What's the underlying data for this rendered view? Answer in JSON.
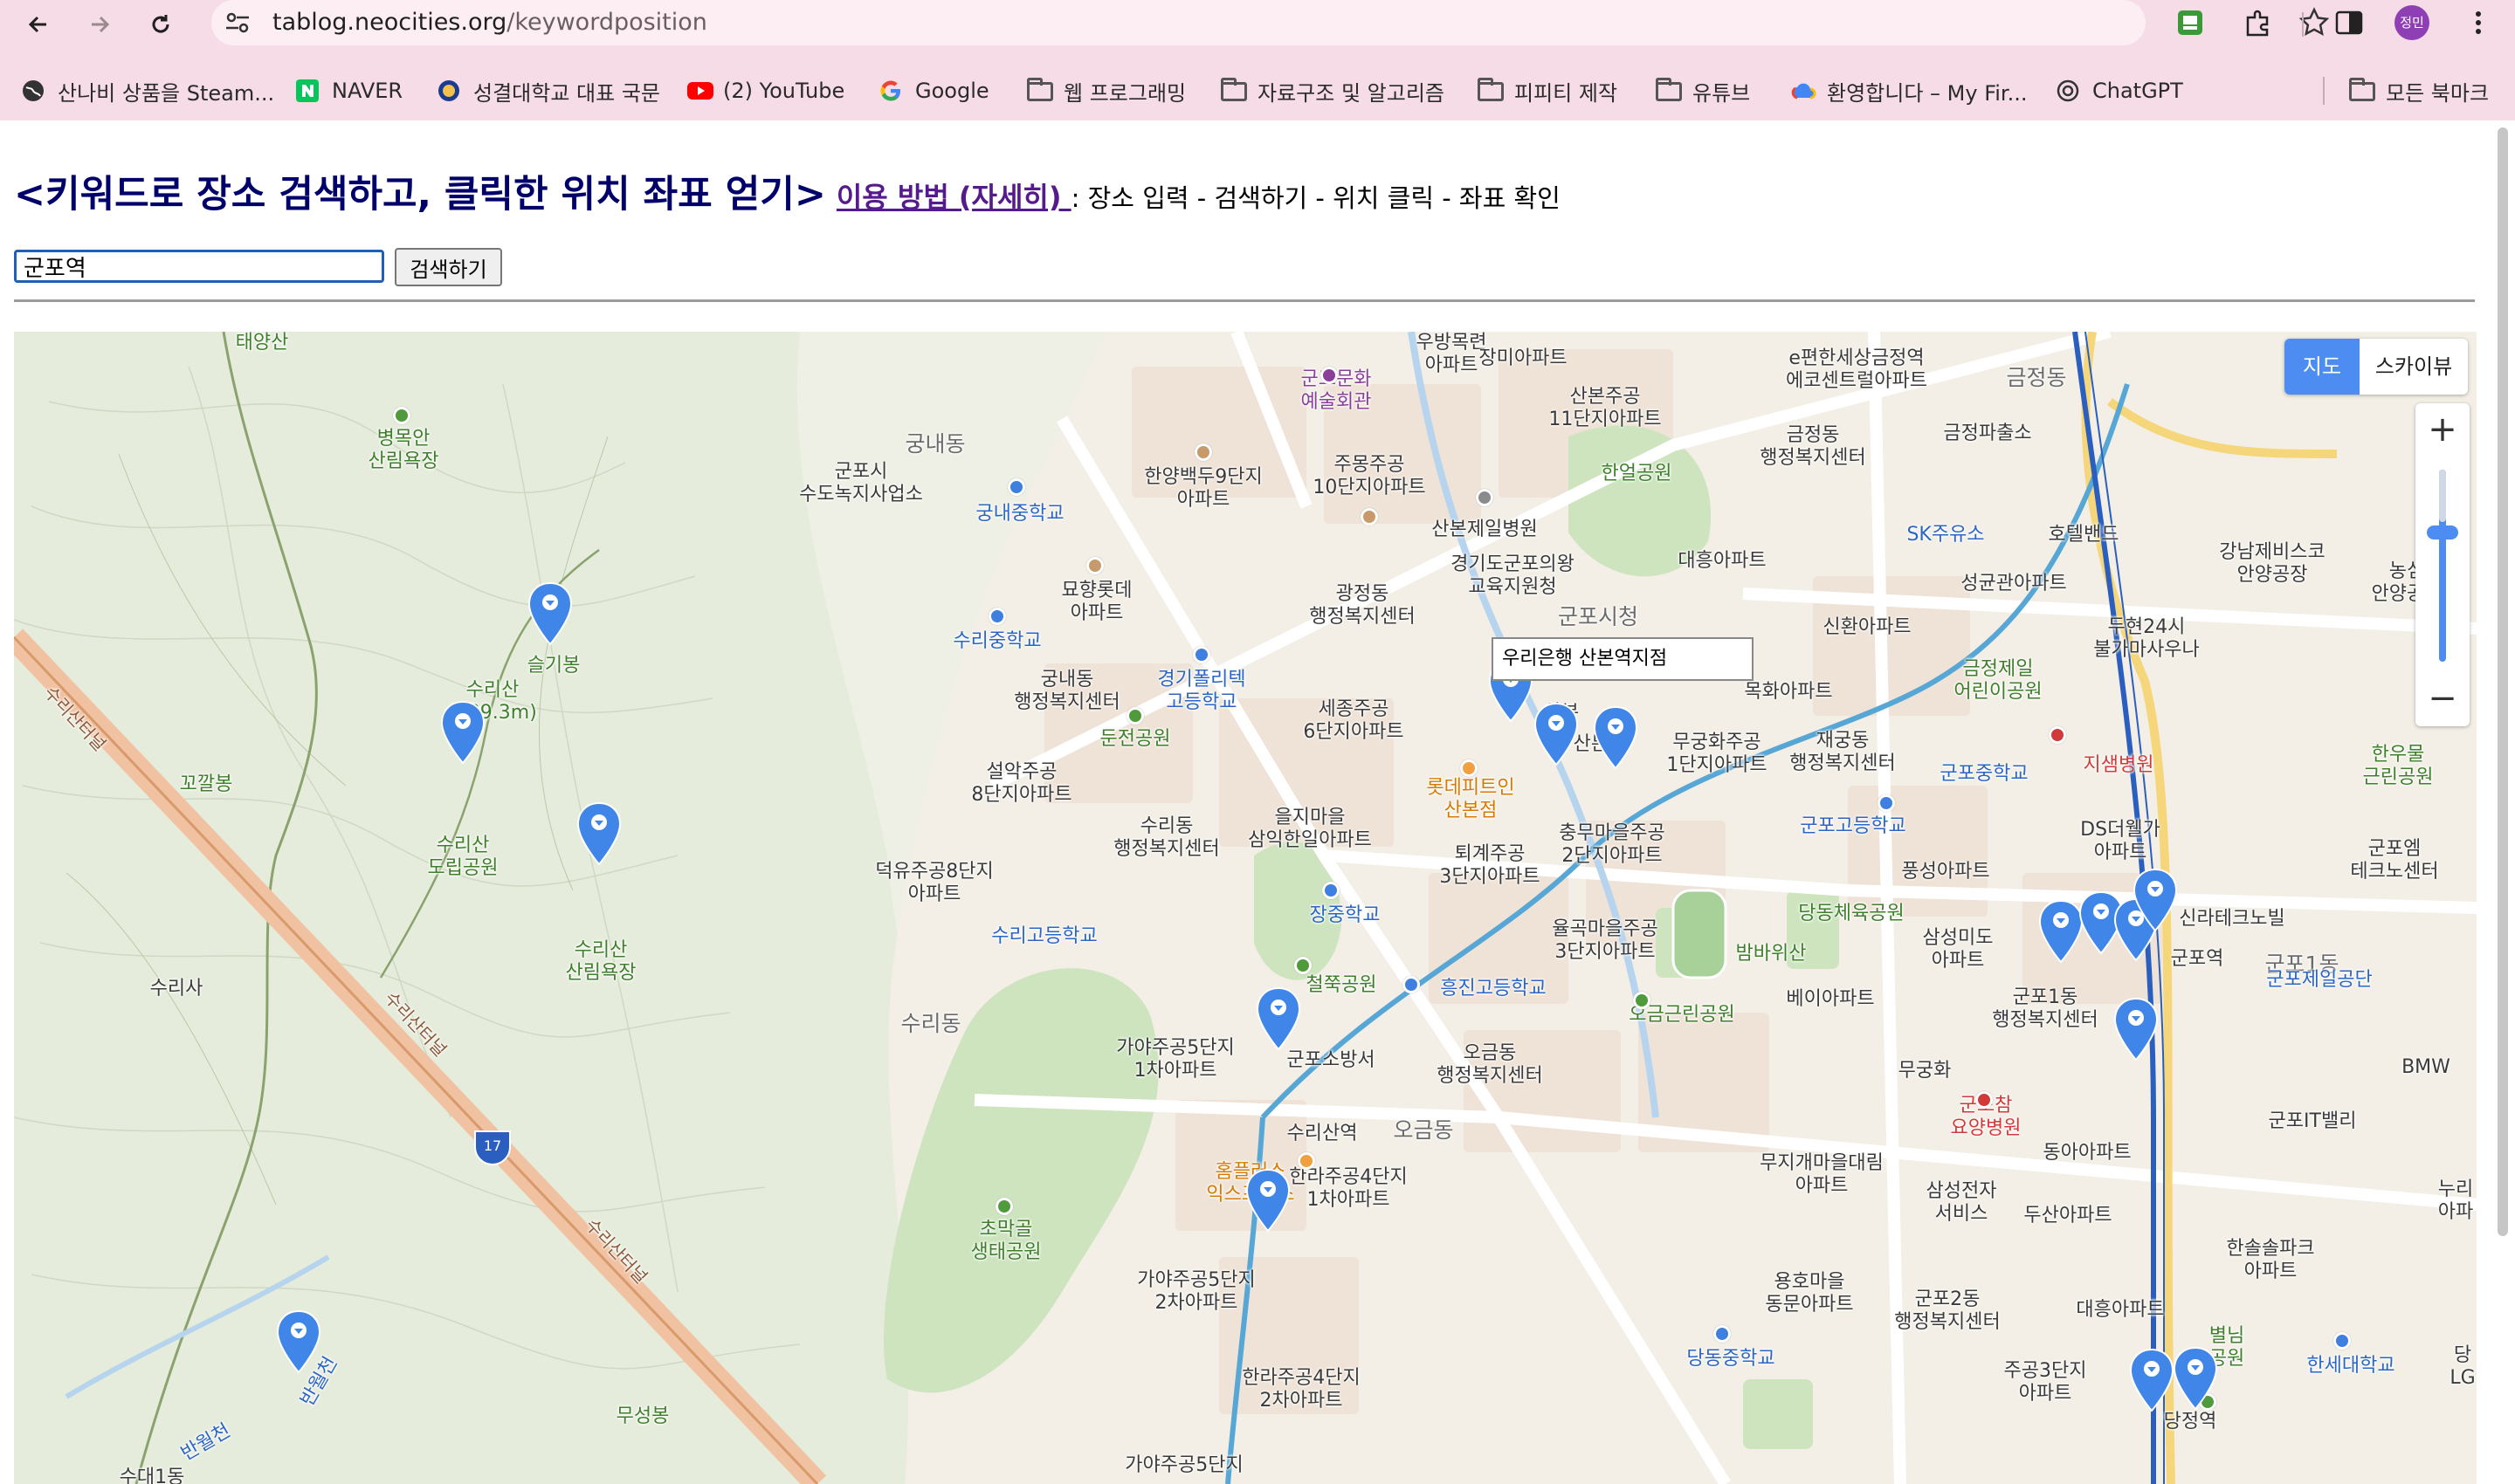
{
  "browser": {
    "url_host": "tablog.neocities.org",
    "url_path": "/keywordposition",
    "profile_label": "정민",
    "bookmarks": [
      "산나비 상품을 Steam...",
      "NAVER",
      "성결대학교 대표 국문",
      "(2) YouTube",
      "Google",
      "웹 프로그래밍",
      "자료구조 및 알고리즘",
      "피피티 제작",
      "유튜브",
      "환영합니다 – My Fir...",
      "ChatGPT",
      "모든 북마크"
    ]
  },
  "page": {
    "title": "<키워드로 장소 검색하고, 클릭한 위치 좌표 얻기>",
    "howto_link": "이용 방법 (자세히) ",
    "steps_text": ": 장소 입력 - 검색하기 - 위치 클릭 - 좌표 확인",
    "search_value": "군포역",
    "search_button": "검색하기"
  },
  "map": {
    "type_active": "지도",
    "type_other": "스카이뷰",
    "zoom_in": "+",
    "zoom_out": "−",
    "infowindow": "우리은행 산본역지점",
    "labels": {
      "taeyangsan": "태양산",
      "byeongmokan": "병목안\n산림욕장",
      "seulgibong": "슬기봉",
      "surisan_peak": "수리산\n(489.3m)",
      "kkakkalbong": "꼬깔봉",
      "surisan_park": "수리산\n도립공원",
      "surisan_forest": "수리산\n산림욕장",
      "surisa": "수리사",
      "suri_tunnel1": "수리산터널",
      "suri_tunnel2": "수리산터널",
      "suri_tunnel3": "수리산터널",
      "banwolcheon1": "반월천",
      "banwolcheon2": "반월천",
      "museongbong": "무성봉",
      "sudae": "수대1동",
      "gungnae": "궁내동",
      "gunpo_water": "군포시\n수도녹지사업소",
      "gungnae_ms": "궁내중학교",
      "suri_ms": "수리중학교",
      "myohyang": "묘향롯데\n아파트",
      "gungnae_office": "궁내동\n행정복지센터",
      "gyeonggi_poly": "경기폴리텍\n고등학교",
      "dunjeon": "둔전공원",
      "seorak": "설악주공\n8단지아파트",
      "sulidong_office": "수리동\n행정복지센터",
      "deokyu": "덕유주공8단지\n아파트",
      "suri_hs": "수리고등학교",
      "surido": "수리동",
      "gayajugong5_1": "가야주공5단지\n1차아파트",
      "homeplus": "홈플러스\n익스프레스",
      "chomakgol": "초막골\n생태공원",
      "surisan_stn": "수리산역",
      "culture_hall": "군포문화\n예술회관",
      "jangmi": "장미아파트",
      "woobang": "우방목련\n아파트",
      "hanyang9": "한양백두9단지\n아파트",
      "jumong10": "주몽주공\n10단지아파트",
      "sanbon_cheil": "산본제일병원",
      "gwangjeong": "광정동\n행정복지센터",
      "gyeonggi_edu": "경기도군포의왕\n교육지원청",
      "sejong6": "세종주공\n6단지아파트",
      "euljimaeul": "을지마을\n삼익한일아파트",
      "jangsin_ms": "장중학교",
      "cheolchuk": "철쭉공원",
      "gunpo_fire": "군포소방서",
      "hanra4_1": "한라주공4단지\n1차아파트",
      "gayajugong5_2": "가야주공5단지\n2차아파트",
      "hanra4_2": "한라주공4단지\n2차아파트",
      "gayajugong5_3": "가야주공5단지",
      "sanbon11": "산본주공\n11단지아파트",
      "hanul_park": "한얼공원",
      "daeheung": "대흥아파트",
      "gunpo_city": "군포시청",
      "lotte": "롯데피트인\n산본점",
      "sanbon_stn": "산본역",
      "mokhwa": "목화아파트",
      "mugunghwa1": "무궁화주공\n1단지아파트",
      "jaegung_office": "재궁동\n행정복지센터",
      "toegye3": "퇴계주공\n3단지아파트",
      "chungmu2": "충무마을주공\n2단지아파트",
      "yulgok3": "율곡마을주공\n3단지아파트",
      "heungjin_hs": "흥진고등학교",
      "ogeum_office": "오금동\n행정복지센터",
      "ogeum_park": "오금근린공원",
      "ogeumdong": "오금동",
      "ehyeon": "e편한세상금정역\n에코센트럴아파트",
      "geumjeongdong": "금정동",
      "geumjeong_office": "금정동\n행정복지센터",
      "geumjeong_police": "금정파출소",
      "sk_gas": "SK주유소",
      "seonggyun": "성균관아파트",
      "sinhwan": "신환아파트",
      "geumjeong_park": "금정제일\n어린이공원",
      "gunpo_hs": "군포고등학교",
      "gunpo_ms": "군포중학교",
      "dangdong_gym": "당동체육공원",
      "bambawi": "밤바위산",
      "beia": "베이아파트",
      "samsungmido": "삼성미도\n아파트",
      "gunpo1_office": "군포1동\n행정복지센터",
      "pungseong": "풍성아파트",
      "ds_the": "DS더웰가\n아파트",
      "hotel": "호텔밴드",
      "dooh24": "두현24시\n불가마사우나",
      "jiseom": "지샘병원",
      "silla_tech": "신라테크노빌",
      "gunpo_stn": "군포역",
      "gunpo1dong": "군포1동",
      "gunpo_jeil": "군포제일공단",
      "mugunghwa": "무궁화",
      "gunpo_cham": "군포참\n요양병원",
      "dong_apt": "동아아파트",
      "mujigae": "무지개마을대림\n아파트",
      "samsung_svc": "삼성전자\n서비스",
      "dusan": "두산아파트",
      "yongho": "용호마을\n동문아파트",
      "gunpo2_office": "군포2동\n행정복지센터",
      "dangdong_ms": "당동중학교",
      "jugong3": "주공3단지\n아파트",
      "daeheung2": "대흥아파트",
      "dangjeong_stn": "당정역",
      "hansol": "한솔솔파크\n아파트",
      "hansei": "한세대학교",
      "gangnam_svc": "강남제비스코\n안양공장",
      "nongsim": "농심\n안양공장",
      "hanwool": "한우물\n근린공원",
      "gunpo_em": "군포엠\n테크노센터",
      "gunpo_it": "군포IT밸리",
      "bmw": "BMW",
      "nuri": "누리\n아파",
      "byeolim": "별님\n공원",
      "dang_lg": "당\nLG",
      "sanbonmark": "산본",
      "sanbon_label2": "산본",
      "route17": "17"
    }
  }
}
